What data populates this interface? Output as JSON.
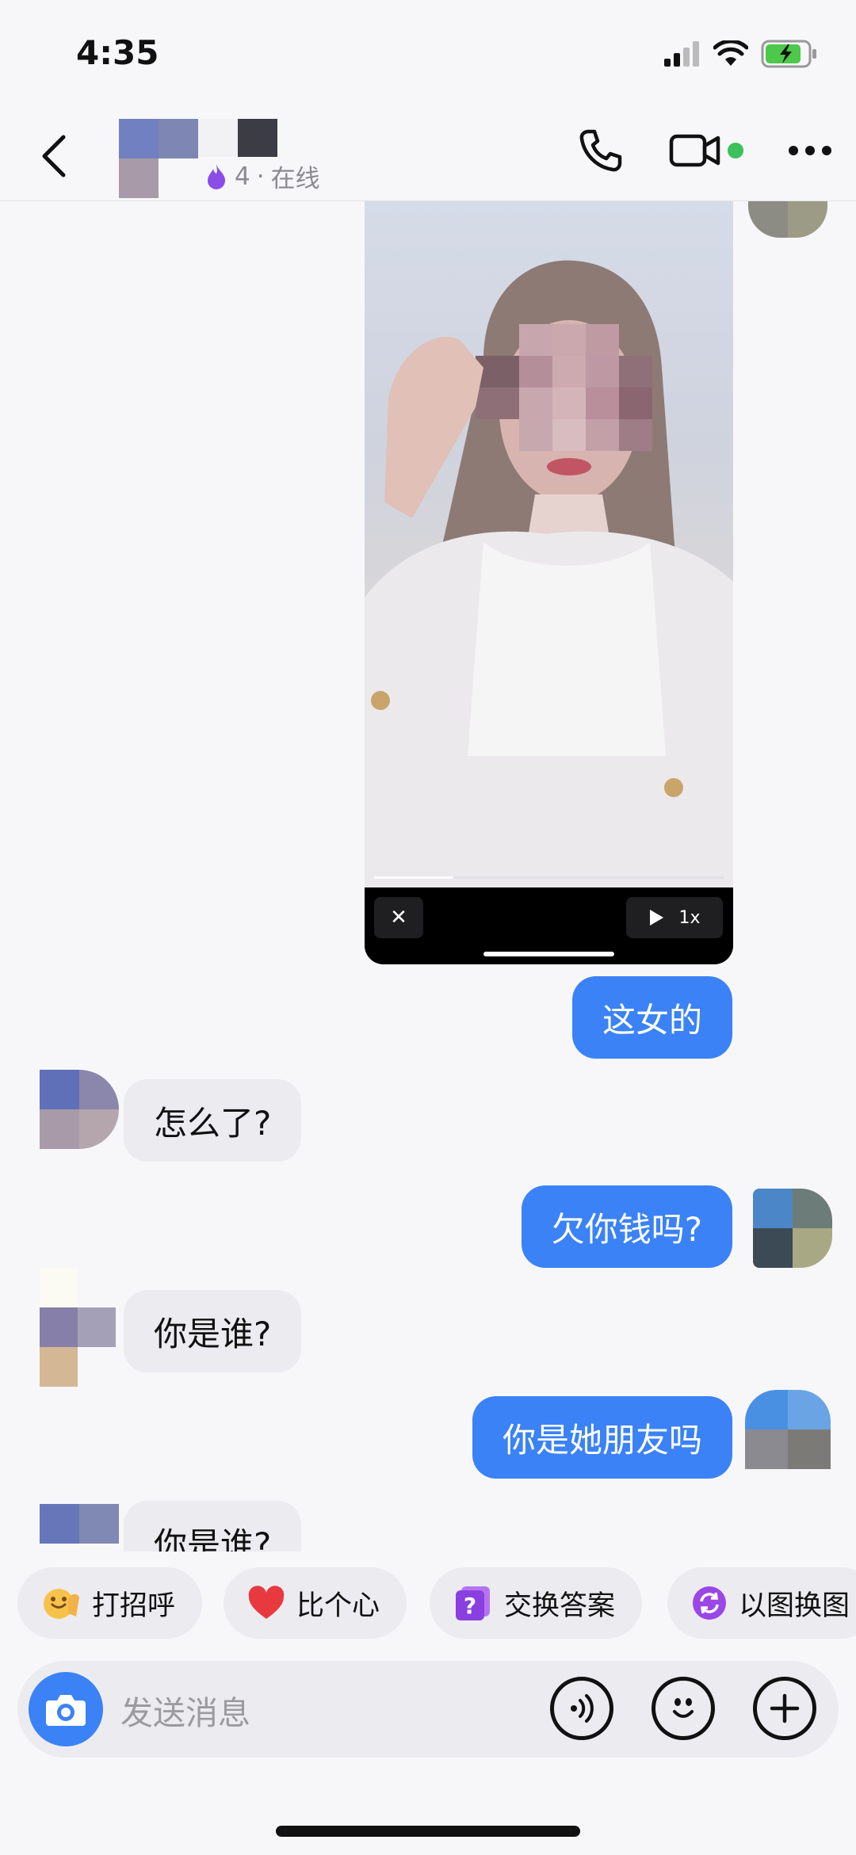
{
  "status_bar": {
    "time": "4:35"
  },
  "header": {
    "level": "4",
    "separator": "·",
    "presence": "在线"
  },
  "video_message": {
    "close_label": "✕",
    "speed_label": "1x"
  },
  "messages": [
    {
      "side": "out",
      "text": "这女的"
    },
    {
      "side": "in",
      "text": "怎么了?"
    },
    {
      "side": "out",
      "text": "欠你钱吗?"
    },
    {
      "side": "in",
      "text": "你是谁?"
    },
    {
      "side": "out",
      "text": "你是她朋友吗"
    },
    {
      "side": "in",
      "text": "你是谁?"
    }
  ],
  "quick_replies": [
    {
      "label": "打招呼",
      "icon": "wave-emoji-icon"
    },
    {
      "label": "比个心",
      "icon": "heart-icon"
    },
    {
      "label": "交换答案",
      "icon": "question-card-icon"
    },
    {
      "label": "以图换图",
      "icon": "image-swap-icon"
    }
  ],
  "input": {
    "placeholder": "发送消息"
  },
  "colors": {
    "accent": "#3b82f6",
    "online": "#3cc05a",
    "bubble_in": "#ececf0",
    "background": "#f7f7f9"
  }
}
